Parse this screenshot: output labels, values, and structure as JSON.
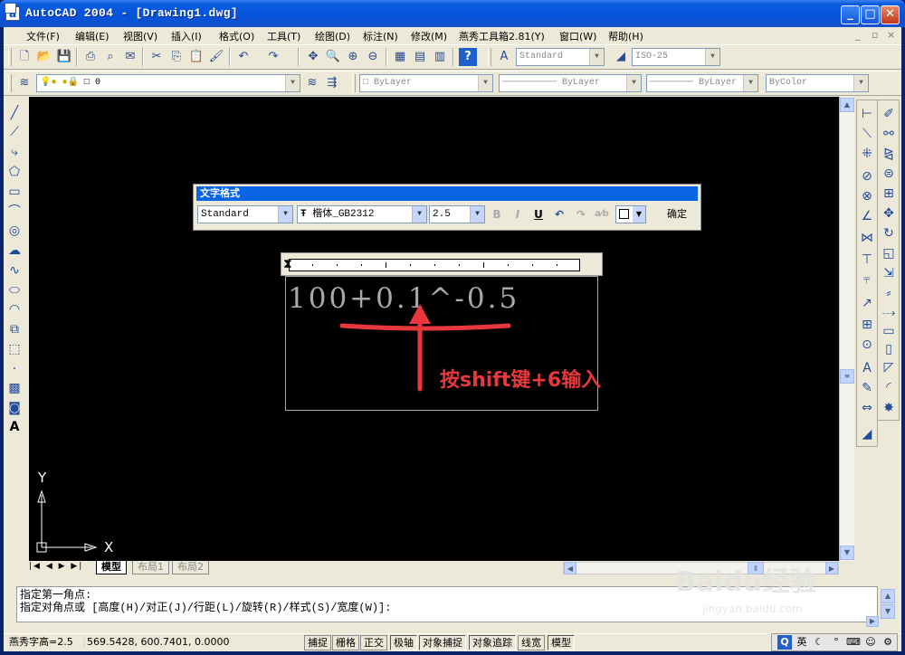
{
  "window": {
    "title": "AutoCAD 2004 - [Drawing1.dwg]",
    "app_icon": "a"
  },
  "menu": [
    "文件(F)",
    "编辑(E)",
    "视图(V)",
    "插入(I)",
    "格式(O)",
    "工具(T)",
    "绘图(D)",
    "标注(N)",
    "修改(M)",
    "燕秀工具箱2.81(Y)",
    "窗口(W)",
    "帮助(H)"
  ],
  "toolbar": {
    "text_style": "Standard",
    "dim_style": "ISO-25",
    "layer_name": "0",
    "color": "ByLayer",
    "linetype": "ByLayer",
    "lineweight": "ByLayer",
    "plot_style": "ByColor"
  },
  "text_format": {
    "title": "文字格式",
    "style": "Standard",
    "font": "楷体_GB2312",
    "height": "2.5",
    "bold": "B",
    "italic": "I",
    "underline": "U",
    "ok": "确定"
  },
  "mtext": {
    "content": "100+0.1^-0.5"
  },
  "annotation": {
    "text": "按shift键+6输入",
    "color": "#e8383d"
  },
  "ucs": {
    "x_label": "X",
    "y_label": "Y"
  },
  "tabs": [
    "模型",
    "布局1",
    "布局2"
  ],
  "command": {
    "line1": "指定第一角点:",
    "line2": "指定对角点或 [高度(H)/对正(J)/行距(L)/旋转(R)/样式(S)/宽度(W)]:"
  },
  "status": {
    "label": "燕秀字高=2.5",
    "coords": "569.5428, 600.7401, 0.0000",
    "buttons": [
      "捕捉",
      "栅格",
      "正交",
      "极轴",
      "对象捕捉",
      "对象追踪",
      "线宽",
      "模型"
    ]
  },
  "ime": {
    "lang": "英"
  },
  "watermark": {
    "brand": "Baidu经验",
    "url": "jingyan.baidu.com"
  }
}
